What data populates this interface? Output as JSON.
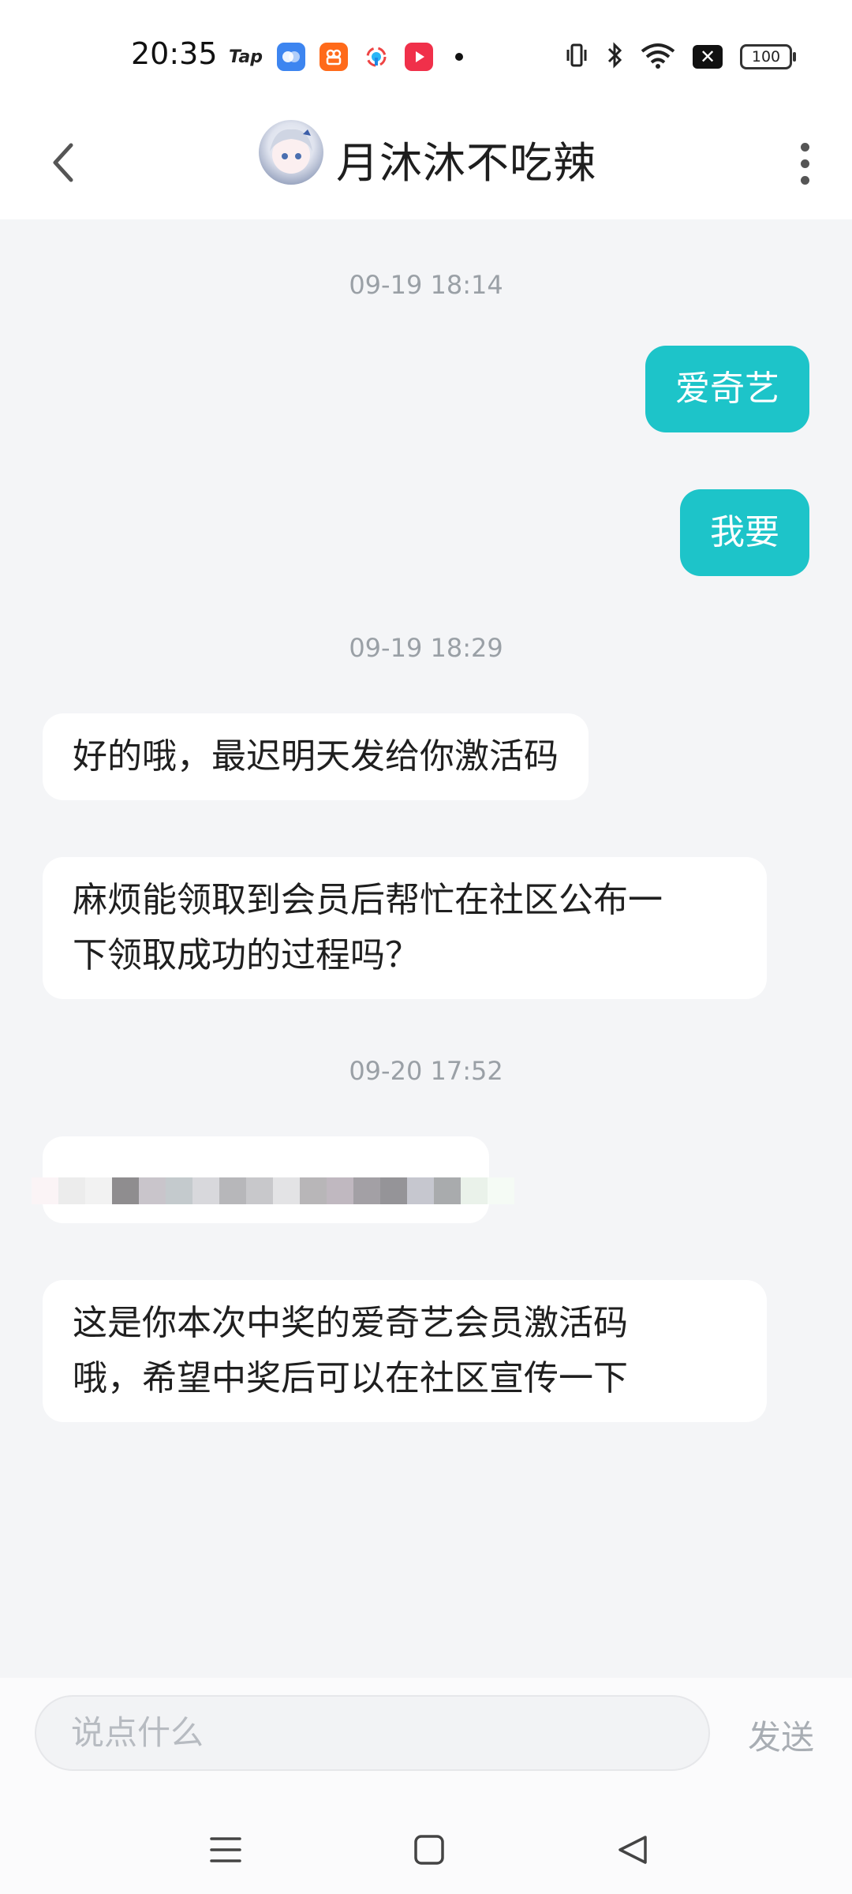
{
  "status_bar": {
    "time": "20:35",
    "app_tap_label": "Tap",
    "battery": "100",
    "icons": [
      "tap-icon",
      "app-blue-icon",
      "app-orange-icon",
      "app-colorful-icon",
      "app-red-play-icon",
      "vibrate-icon",
      "bluetooth-icon",
      "wifi-icon",
      "x-app-icon",
      "battery-icon"
    ]
  },
  "header": {
    "title": "月沐沐不吃辣"
  },
  "chat": {
    "timestamps": [
      "09-19 18:14",
      "09-19 18:29",
      "09-20 17:52"
    ],
    "messages": [
      {
        "side": "out",
        "text": "爱奇艺"
      },
      {
        "side": "out",
        "text": "我要"
      },
      {
        "side": "in",
        "text": "好的哦，最迟明天发给你激活码"
      },
      {
        "side": "in",
        "line1": "麻烦能领取到会员后帮忙在社区公布一",
        "line2": "下领取成功的过程吗？"
      },
      {
        "side": "in",
        "text": "",
        "note": "pixelated activation code"
      },
      {
        "side": "in",
        "line1": "这是你本次中奖的爱奇艺会员激活码",
        "line2": "哦，希望中奖后可以在社区宣传一下"
      }
    ]
  },
  "input": {
    "placeholder": "说点什么",
    "send_label": "发送"
  },
  "colors": {
    "outgoing_bubble": "#1dc4c9",
    "incoming_bubble": "#ffffff",
    "chat_background": "#f4f5f7"
  }
}
